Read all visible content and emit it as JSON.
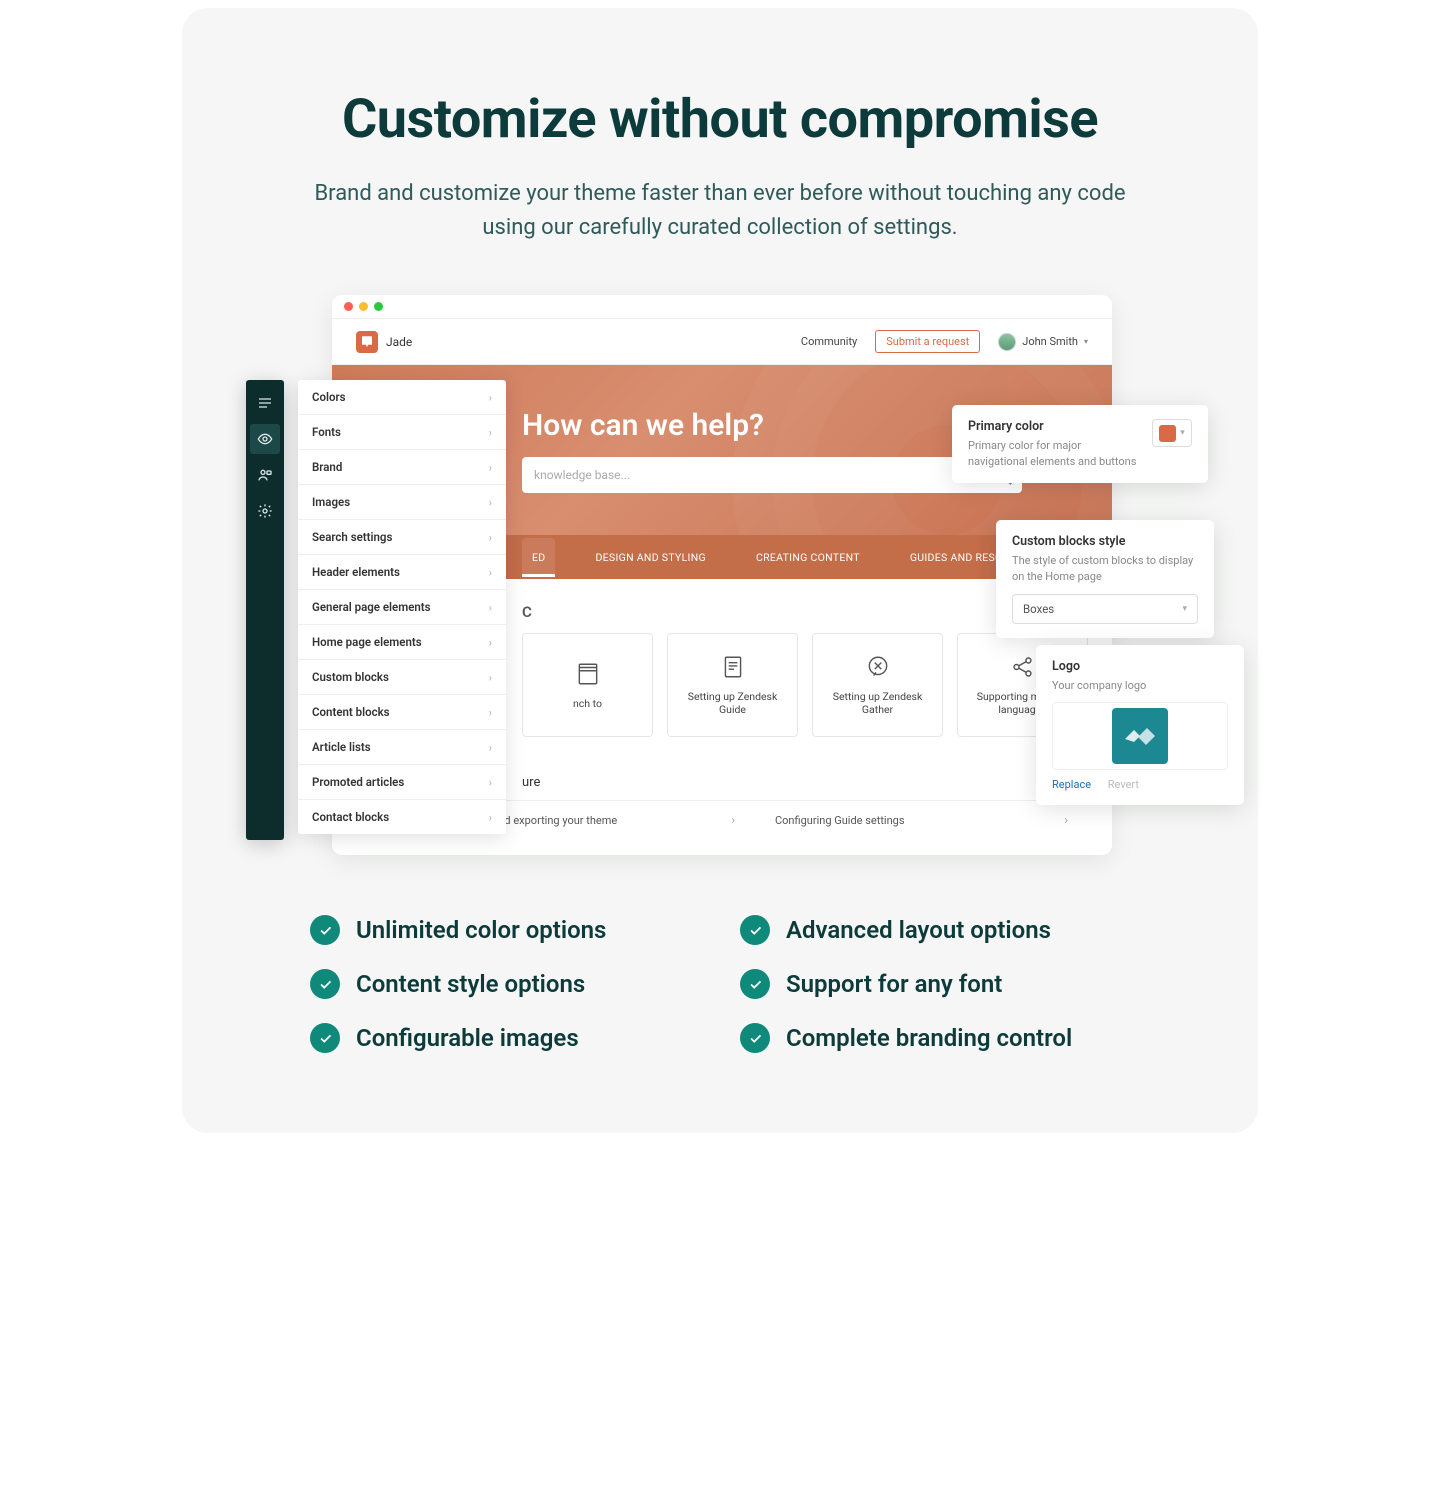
{
  "hero": {
    "title": "Customize without compromise",
    "subtitle": "Brand and customize your theme faster than ever before without touching any code using our carefully curated collection of settings."
  },
  "app": {
    "brand_name": "Jade",
    "nav_community": "Community",
    "submit_label": "Submit a request",
    "user_name": "John Smith",
    "banner_heading": "How can we help?",
    "search_placeholder": "knowledge base...",
    "tabs": [
      "ED",
      "DESIGN AND STYLING",
      "CREATING CONTENT",
      "GUIDES AND RESOURCES"
    ],
    "section_marker": "C",
    "cards": [
      "nch to",
      "Setting up Zendesk Guide",
      "Setting up Zendesk Gather",
      "Supporting multiple languages"
    ],
    "subheading_fragment": "ure",
    "footer_links": [
      "Importing and exporting your theme",
      "Configuring Guide settings"
    ]
  },
  "settings_items": [
    "Colors",
    "Fonts",
    "Brand",
    "Images",
    "Search settings",
    "Header elements",
    "General page elements",
    "Home page elements",
    "Custom blocks",
    "Content blocks",
    "Article lists",
    "Promoted articles",
    "Contact blocks"
  ],
  "panels": {
    "primary": {
      "title": "Primary color",
      "desc": "Primary color for major navigational elements and buttons",
      "color": "#d96a46"
    },
    "blocks": {
      "title": "Custom blocks style",
      "desc": "The style of custom blocks to display on the Home page",
      "selected": "Boxes"
    },
    "logo": {
      "title": "Logo",
      "desc": "Your company logo",
      "replace": "Replace",
      "revert": "Revert"
    }
  },
  "features": [
    "Unlimited color options",
    "Advanced layout options",
    "Content style options",
    "Support for any font",
    "Configurable images",
    "Complete branding control"
  ]
}
